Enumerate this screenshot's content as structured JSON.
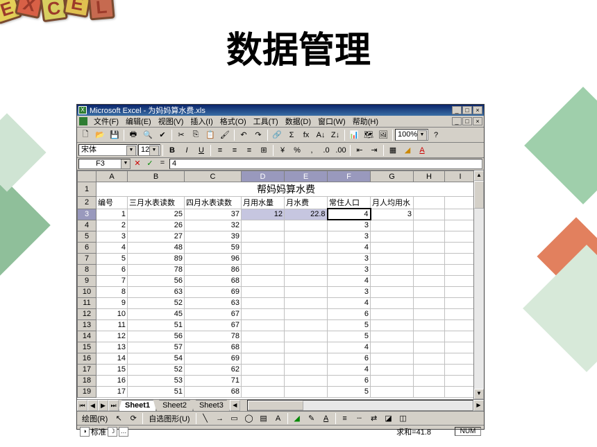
{
  "slide": {
    "title": "数据管理",
    "logoLetters": [
      "E",
      "X",
      "C",
      "E",
      "L"
    ]
  },
  "window": {
    "title": "Microsoft Excel - 为妈妈算水费.xls",
    "btns": {
      "min": "_",
      "max": "□",
      "close": "×"
    }
  },
  "menus": [
    "文件(F)",
    "编辑(E)",
    "视图(V)",
    "插入(I)",
    "格式(O)",
    "工具(T)",
    "数据(D)",
    "窗口(W)",
    "帮助(H)"
  ],
  "fontName": "宋体",
  "fontSize": "12",
  "zoom": "100%",
  "formulaBar": {
    "cellRef": "F3",
    "value": "4",
    "eq": "="
  },
  "columns": [
    "A",
    "B",
    "C",
    "D",
    "E",
    "F",
    "G",
    "H",
    "I"
  ],
  "merged_title": "帮妈妈算水费",
  "headers": [
    "编号",
    "三月水表读数",
    "四月水表读数",
    "月用水量",
    "月水费",
    "常住人口",
    "月人均用水"
  ],
  "rows": [
    {
      "r": 3,
      "a": "1",
      "b": "25",
      "c": "37",
      "d": "12",
      "e": "22.8",
      "f": "4",
      "g": "3"
    },
    {
      "r": 4,
      "a": "2",
      "b": "26",
      "c": "32",
      "d": "",
      "e": "",
      "f": "3",
      "g": ""
    },
    {
      "r": 5,
      "a": "3",
      "b": "27",
      "c": "39",
      "d": "",
      "e": "",
      "f": "3",
      "g": ""
    },
    {
      "r": 6,
      "a": "4",
      "b": "48",
      "c": "59",
      "d": "",
      "e": "",
      "f": "4",
      "g": ""
    },
    {
      "r": 7,
      "a": "5",
      "b": "89",
      "c": "96",
      "d": "",
      "e": "",
      "f": "3",
      "g": ""
    },
    {
      "r": 8,
      "a": "6",
      "b": "78",
      "c": "86",
      "d": "",
      "e": "",
      "f": "3",
      "g": ""
    },
    {
      "r": 9,
      "a": "7",
      "b": "56",
      "c": "68",
      "d": "",
      "e": "",
      "f": "4",
      "g": ""
    },
    {
      "r": 10,
      "a": "8",
      "b": "63",
      "c": "69",
      "d": "",
      "e": "",
      "f": "3",
      "g": ""
    },
    {
      "r": 11,
      "a": "9",
      "b": "52",
      "c": "63",
      "d": "",
      "e": "",
      "f": "4",
      "g": ""
    },
    {
      "r": 12,
      "a": "10",
      "b": "45",
      "c": "67",
      "d": "",
      "e": "",
      "f": "6",
      "g": ""
    },
    {
      "r": 13,
      "a": "11",
      "b": "51",
      "c": "67",
      "d": "",
      "e": "",
      "f": "5",
      "g": ""
    },
    {
      "r": 14,
      "a": "12",
      "b": "56",
      "c": "78",
      "d": "",
      "e": "",
      "f": "5",
      "g": ""
    },
    {
      "r": 15,
      "a": "13",
      "b": "57",
      "c": "68",
      "d": "",
      "e": "",
      "f": "4",
      "g": ""
    },
    {
      "r": 16,
      "a": "14",
      "b": "54",
      "c": "69",
      "d": "",
      "e": "",
      "f": "6",
      "g": ""
    },
    {
      "r": 17,
      "a": "15",
      "b": "52",
      "c": "62",
      "d": "",
      "e": "",
      "f": "4",
      "g": ""
    },
    {
      "r": 18,
      "a": "16",
      "b": "53",
      "c": "71",
      "d": "",
      "e": "",
      "f": "6",
      "g": ""
    },
    {
      "r": 19,
      "a": "17",
      "b": "51",
      "c": "68",
      "d": "",
      "e": "",
      "f": "5",
      "g": ""
    }
  ],
  "sheets": [
    "Sheet1",
    "Sheet2",
    "Sheet3"
  ],
  "drawLabel": "绘图(R)",
  "autoshape": "自选图形(U)",
  "status": {
    "label": "标准",
    "sum": "求和=41.8",
    "kbd": "NUM"
  }
}
